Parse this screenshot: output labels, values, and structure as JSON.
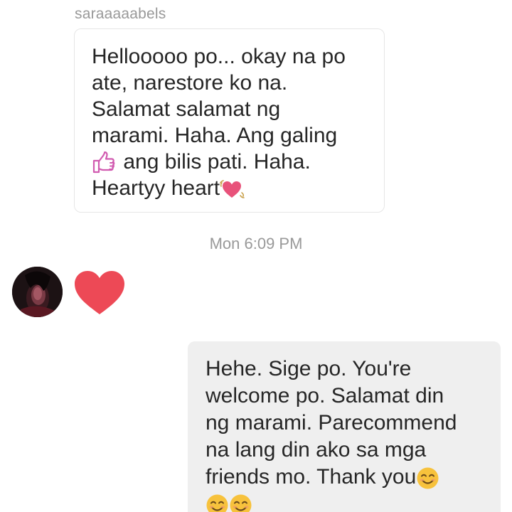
{
  "conversation": {
    "sender_name": "saraaaaabels",
    "incoming_message": {
      "lines": [
        "Hellooooo po... okay na po",
        "ate, narestore ko na.",
        "Salamat salamat ng",
        "marami. Haha. Ang galing",
        " ang bilis pati. Haha.",
        "Heartyy heart"
      ]
    },
    "timestamp": "Mon 6:09 PM",
    "reaction": {
      "icon": "red-heart-icon",
      "color": "#ed4956"
    },
    "outgoing_message": {
      "lines": [
        "Hehe. Sige po. You're",
        "welcome po. Salamat din",
        "ng marami. Parecommend",
        "na lang din ako sa mga",
        "friends mo. Thank you"
      ]
    },
    "emoji_icons": [
      "thumbs-up-icon",
      "beating-heart-icon",
      "smiling-face-icon"
    ],
    "colors": {
      "incoming_border": "#e6e6e6",
      "outgoing_background": "#efefef",
      "meta_text": "#999999",
      "message_text": "#262626",
      "thumbs_up": "#d15bb0",
      "heart": "#e8527a",
      "smiley": "#f7c23c"
    }
  }
}
